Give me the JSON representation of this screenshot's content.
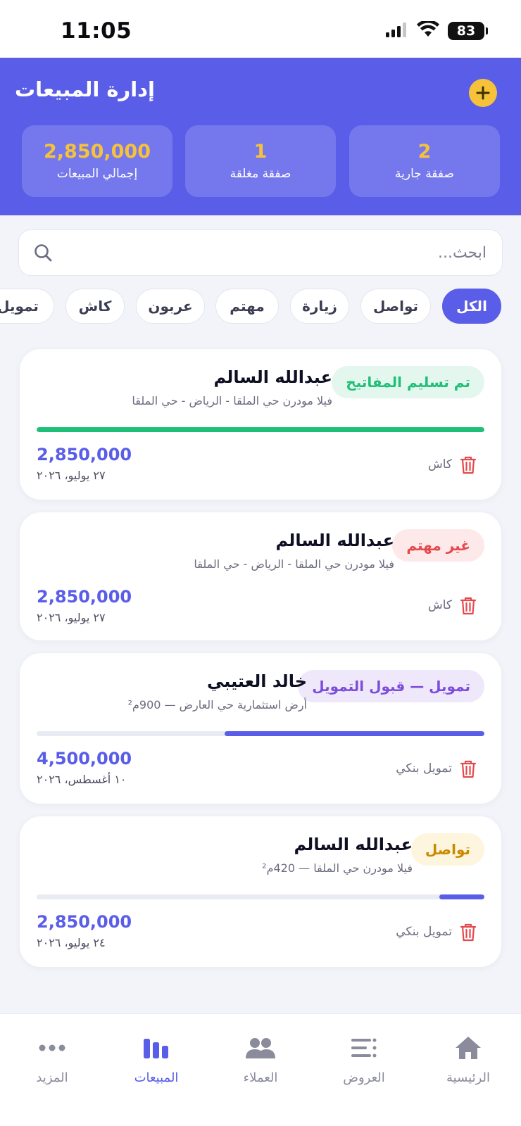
{
  "status_bar": {
    "time": "11:05",
    "battery": "83"
  },
  "header": {
    "title": "إدارة المبيعات",
    "stats": [
      {
        "value": "2,850,000",
        "label": "إجمالي المبيعات"
      },
      {
        "value": "1",
        "label": "صفقة مغلقة"
      },
      {
        "value": "2",
        "label": "صفقة جارية"
      }
    ]
  },
  "search": {
    "placeholder": "ابحث..."
  },
  "filters": [
    "الكل",
    "تواصل",
    "زيارة",
    "مهتم",
    "عربون",
    "كاش",
    "تمويل"
  ],
  "active_filter": "الكل",
  "deals": [
    {
      "status": "تم تسليم المفاتيح",
      "client": "عبدالله السالم",
      "property": "فيلا مودرن حي الملقا - الرياض - حي الملقا",
      "progress": 1.0,
      "amount": "2,850,000",
      "date": "٢٧ يوليو، ٢٠٢٦",
      "payment": "كاش"
    },
    {
      "status": "غير مهتم",
      "client": "عبدالله السالم",
      "property": "فيلا مودرن حي الملقا - الرياض - حي الملقا",
      "amount": "2,850,000",
      "date": "٢٧ يوليو، ٢٠٢٦",
      "payment": "كاش"
    },
    {
      "status": "تمويل — قبول التمويل",
      "client": "خالد العتيبي",
      "property": "أرض استثمارية حي العارض — 900م²",
      "progress": 0.58,
      "amount": "4,500,000",
      "date": "١٠ أغسطس، ٢٠٢٦",
      "payment": "تمويل بنكي"
    },
    {
      "status": "تواصل",
      "client": "عبدالله السالم",
      "property": "فيلا مودرن حي الملقا — 420م²",
      "progress": 0.1,
      "amount": "2,850,000",
      "date": "٢٤ يوليو، ٢٠٢٦",
      "payment": "تمويل بنكي"
    }
  ],
  "nav": {
    "items": [
      "الرئيسية",
      "العروض",
      "العملاء",
      "المبيعات",
      "المزيد"
    ],
    "active": "المبيعات"
  },
  "colors": {
    "primary": "#5a5de8",
    "accent": "#f6c23a",
    "status_delivered": "#1fbf78",
    "status_not_interested": "#e5484d",
    "status_financing": "#7c4ddb",
    "status_contact": "#c98a00"
  }
}
